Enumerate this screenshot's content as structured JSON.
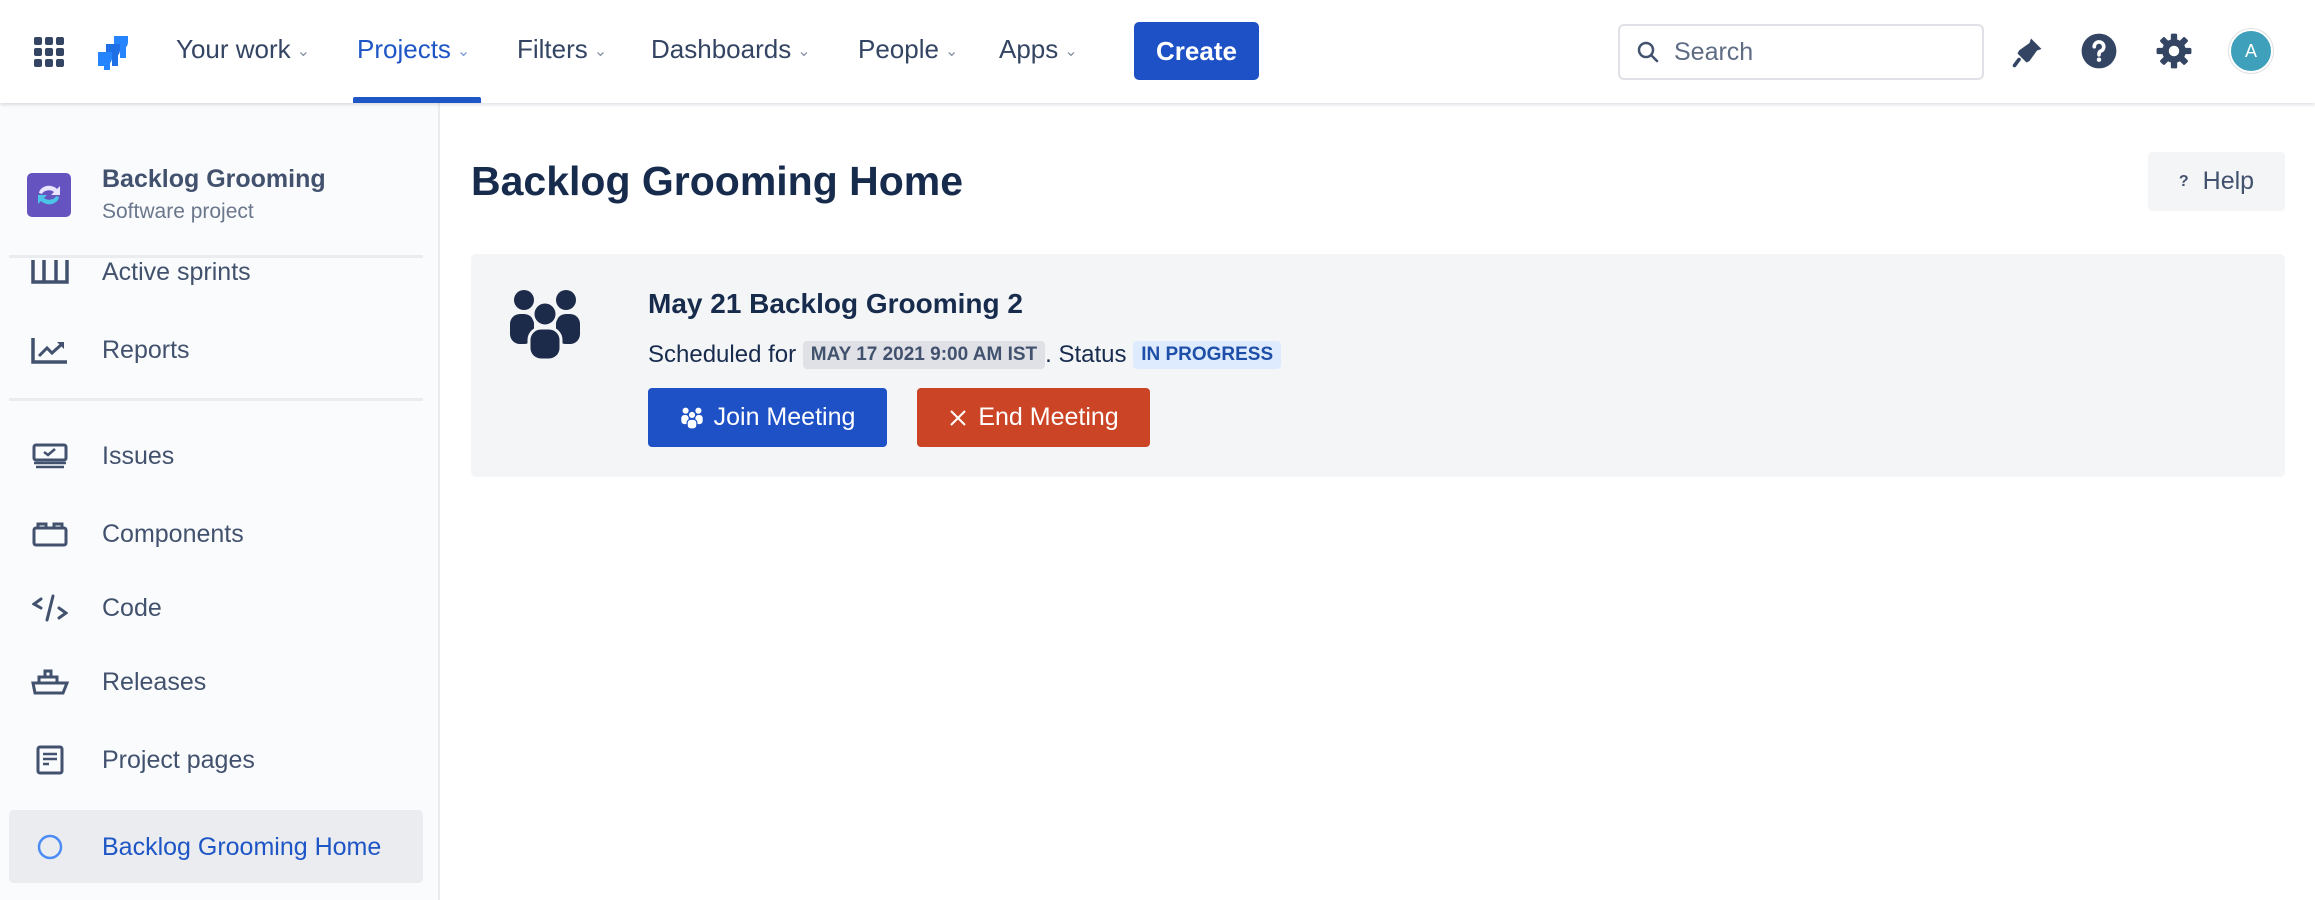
{
  "topbar": {
    "nav": [
      {
        "label": "Your work"
      },
      {
        "label": "Projects",
        "active": true
      },
      {
        "label": "Filters"
      },
      {
        "label": "Dashboards"
      },
      {
        "label": "People"
      },
      {
        "label": "Apps"
      }
    ],
    "create_label": "Create",
    "search_placeholder": "Search",
    "avatar_initial": "A"
  },
  "sidebar": {
    "project_name": "Backlog Grooming",
    "project_type": "Software project",
    "items": [
      {
        "label": "Active sprints",
        "icon": "board-icon"
      },
      {
        "label": "Reports",
        "icon": "chart-icon"
      },
      {
        "label": "Issues",
        "icon": "issues-icon"
      },
      {
        "label": "Components",
        "icon": "component-icon"
      },
      {
        "label": "Code",
        "icon": "code-icon"
      },
      {
        "label": "Releases",
        "icon": "ship-icon"
      },
      {
        "label": "Project pages",
        "icon": "page-icon"
      },
      {
        "label": "Backlog Grooming Home",
        "icon": "circle-icon",
        "selected": true
      }
    ]
  },
  "main": {
    "title": "Backlog Grooming Home",
    "help_label": "Help",
    "meeting": {
      "title": "May 21 Backlog Grooming 2",
      "scheduled_prefix": "Scheduled for",
      "scheduled_date": "MAY 17 2021 9:00 AM IST",
      "status_prefix": ". Status",
      "status": "IN PROGRESS",
      "join_label": "Join Meeting",
      "end_label": "End Meeting"
    }
  },
  "colors": {
    "primary": "#1e50c6",
    "danger": "#ca4425",
    "text": "#172b4d"
  }
}
